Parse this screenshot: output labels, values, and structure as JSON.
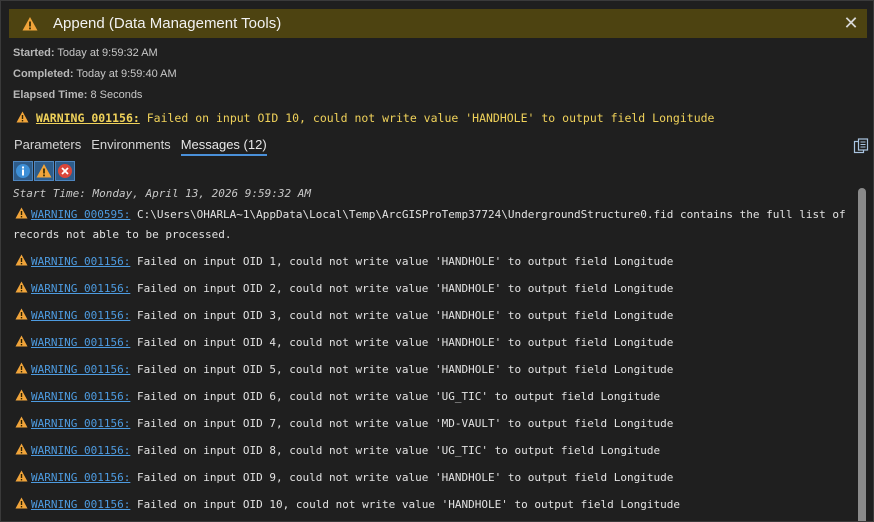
{
  "window": {
    "title": "Append (Data Management Tools)",
    "close_glyph": "✕"
  },
  "meta": {
    "started_label": "Started:",
    "started_value": "Today at 9:59:32 AM",
    "completed_label": "Completed:",
    "completed_value": "Today at 9:59:40 AM",
    "elapsed_label": "Elapsed Time:",
    "elapsed_value": "8 Seconds"
  },
  "summary": {
    "code": "WARNING 001156:",
    "text": "Failed on input OID 10, could not write value 'HANDHOLE' to output field Longitude"
  },
  "tabs": [
    {
      "label": "Parameters"
    },
    {
      "label": "Environments"
    },
    {
      "label": "Messages (12)"
    }
  ],
  "filters": {
    "info": "i",
    "warning": "!",
    "error": "×"
  },
  "messages": {
    "start_time": "Start Time: Monday, April 13, 2026 9:59:32 AM",
    "items": [
      {
        "code": "WARNING 000595:",
        "text": "C:\\Users\\OHARLA~1\\AppData\\Local\\Temp\\ArcGISProTemp37724\\UndergroundStructure0.fid contains the full list of records not able to be processed."
      },
      {
        "code": "WARNING 001156:",
        "text": "Failed on input OID 1, could not write value 'HANDHOLE' to output field Longitude"
      },
      {
        "code": "WARNING 001156:",
        "text": "Failed on input OID 2, could not write value 'HANDHOLE' to output field Longitude"
      },
      {
        "code": "WARNING 001156:",
        "text": "Failed on input OID 3, could not write value 'HANDHOLE' to output field Longitude"
      },
      {
        "code": "WARNING 001156:",
        "text": "Failed on input OID 4, could not write value 'HANDHOLE' to output field Longitude"
      },
      {
        "code": "WARNING 001156:",
        "text": "Failed on input OID 5, could not write value 'HANDHOLE' to output field Longitude"
      },
      {
        "code": "WARNING 001156:",
        "text": "Failed on input OID 6, could not write value 'UG_TIC' to output field Longitude"
      },
      {
        "code": "WARNING 001156:",
        "text": "Failed on input OID 7, could not write value 'MD-VAULT' to output field Longitude"
      },
      {
        "code": "WARNING 001156:",
        "text": "Failed on input OID 8, could not write value 'UG_TIC' to output field Longitude"
      },
      {
        "code": "WARNING 001156:",
        "text": "Failed on input OID 9, could not write value 'HANDHOLE' to output field Longitude"
      },
      {
        "code": "WARNING 001156:",
        "text": "Failed on input OID 10, could not write value 'HANDHOLE' to output field Longitude"
      }
    ]
  },
  "colors": {
    "titlebar": "#4d4311",
    "warning_text": "#f0d25a",
    "link": "#4d9be0",
    "tab_underline": "#4a90d9"
  }
}
